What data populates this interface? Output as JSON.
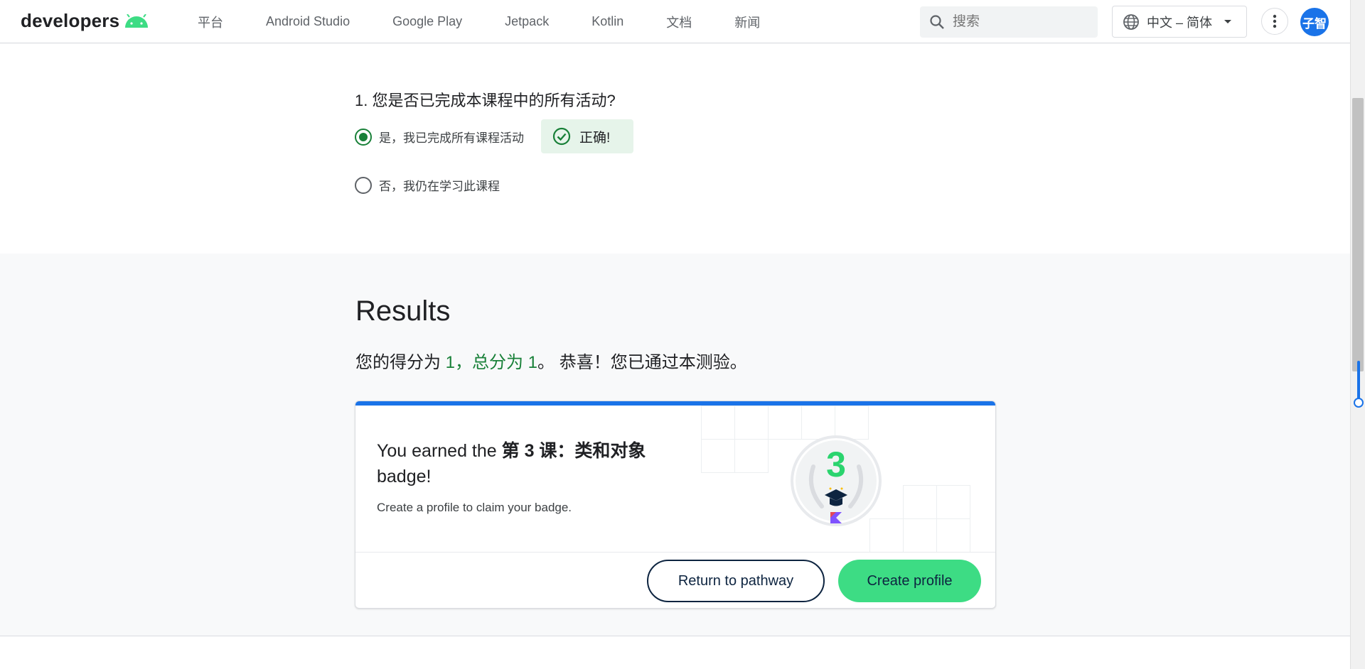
{
  "header": {
    "logo_text": "developers",
    "nav": [
      "平台",
      "Android Studio",
      "Google Play",
      "Jetpack",
      "Kotlin",
      "文档",
      "新闻"
    ],
    "search_placeholder": "搜索",
    "language": "中文 – 简体",
    "avatar_text": "子智"
  },
  "quiz": {
    "question": "1. 您是否已完成本课程中的所有活动?",
    "options": [
      {
        "label": "是，我已完成所有课程活动",
        "selected": true
      },
      {
        "label": "否，我仍在学习此课程",
        "selected": false
      }
    ],
    "feedback": "正确!"
  },
  "results": {
    "title": "Results",
    "score_prefix": "您的得分为 ",
    "score_value": "1，总分为 1",
    "score_suffix": "。 恭喜！您已通过本测验。"
  },
  "badge_card": {
    "earned_prefix": "You earned the ",
    "badge_name": "第 3 课：类和对象",
    "earned_suffix": " badge!",
    "subtext": "Create a profile to claim your badge.",
    "badge_number": "3",
    "return_button": "Return to pathway",
    "create_button": "Create profile"
  },
  "colors": {
    "accent_blue": "#1a73e8",
    "success_green": "#188038",
    "android_green": "#3ddc84"
  }
}
